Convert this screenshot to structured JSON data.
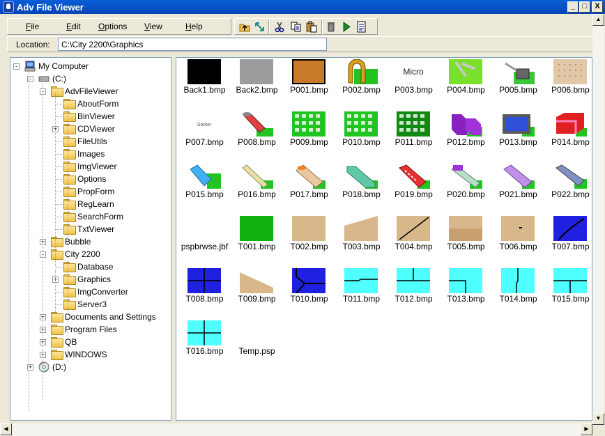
{
  "window": {
    "title": "Adv File Viewer"
  },
  "caption_buttons": {
    "minimize": "_",
    "maximize": "□",
    "close": "X"
  },
  "menu": [
    {
      "label": "File",
      "ul": "F",
      "rest": "ile"
    },
    {
      "label": "Edit",
      "ul": "E",
      "rest": "dit"
    },
    {
      "label": "Options",
      "ul": "O",
      "rest": "ptions"
    },
    {
      "label": "View",
      "ul": "V",
      "rest": "iew"
    },
    {
      "label": "Help",
      "ul": "H",
      "rest": "elp"
    }
  ],
  "toolbar": [
    {
      "icon": "folder-up-icon"
    },
    {
      "icon": "resize-icon"
    },
    {
      "icon": "cut-icon"
    },
    {
      "icon": "copy-icon"
    },
    {
      "icon": "paste-icon"
    },
    {
      "icon": "delete-icon"
    },
    {
      "icon": "run-icon"
    },
    {
      "icon": "properties-icon"
    }
  ],
  "location": {
    "label": "Location:",
    "value": "C:\\City 2200\\Graphics"
  },
  "tree": [
    {
      "label": "My Computer",
      "level": 0,
      "kind": "computer",
      "expander": "-"
    },
    {
      "label": "(C:)",
      "level": 1,
      "kind": "drive",
      "expander": "-"
    },
    {
      "label": "AdvFileViewer",
      "level": 2,
      "kind": "folder",
      "expander": "-"
    },
    {
      "label": "AboutForm",
      "level": 3,
      "kind": "folder",
      "expander": ""
    },
    {
      "label": "BinViewer",
      "level": 3,
      "kind": "folder",
      "expander": ""
    },
    {
      "label": "CDViewer",
      "level": 3,
      "kind": "folder",
      "expander": "+"
    },
    {
      "label": "FileUtils",
      "level": 3,
      "kind": "folder",
      "expander": ""
    },
    {
      "label": "Images",
      "level": 3,
      "kind": "folder",
      "expander": ""
    },
    {
      "label": "ImgViewer",
      "level": 3,
      "kind": "folder",
      "expander": ""
    },
    {
      "label": "Options",
      "level": 3,
      "kind": "folder",
      "expander": ""
    },
    {
      "label": "PropForm",
      "level": 3,
      "kind": "folder",
      "expander": ""
    },
    {
      "label": "RegLearn",
      "level": 3,
      "kind": "folder",
      "expander": ""
    },
    {
      "label": "SearchForm",
      "level": 3,
      "kind": "folder",
      "expander": ""
    },
    {
      "label": "TxtViewer",
      "level": 3,
      "kind": "folder",
      "expander": ""
    },
    {
      "label": "Bubble",
      "level": 2,
      "kind": "folder",
      "expander": "+"
    },
    {
      "label": "City 2200",
      "level": 2,
      "kind": "folder",
      "expander": "-"
    },
    {
      "label": "Database",
      "level": 3,
      "kind": "folder",
      "expander": ""
    },
    {
      "label": "Graphics",
      "level": 3,
      "kind": "folder",
      "expander": "+"
    },
    {
      "label": "ImgConverter",
      "level": 3,
      "kind": "folder",
      "expander": ""
    },
    {
      "label": "Server3",
      "level": 3,
      "kind": "folder",
      "expander": ""
    },
    {
      "label": "Documents and Settings",
      "level": 2,
      "kind": "folder",
      "expander": "+"
    },
    {
      "label": "Program Files",
      "level": 2,
      "kind": "folder",
      "expander": "+"
    },
    {
      "label": "QB",
      "level": 2,
      "kind": "folder",
      "expander": "+"
    },
    {
      "label": "WINDOWS",
      "level": 2,
      "kind": "folder",
      "expander": "+"
    },
    {
      "label": "(D:)",
      "level": 1,
      "kind": "cdrom",
      "expander": "+"
    }
  ],
  "files": [
    {
      "name": "Back1.bmp",
      "thumb": "black"
    },
    {
      "name": "Back2.bmp",
      "thumb": "gray"
    },
    {
      "name": "P001.bmp",
      "thumb": "brown"
    },
    {
      "name": "P002.bmp",
      "thumb": "arch"
    },
    {
      "name": "P003.bmp",
      "thumb": "micro",
      "text": "Micro"
    },
    {
      "name": "P004.bmp",
      "thumb": "greenpick"
    },
    {
      "name": "P005.bmp",
      "thumb": "machine"
    },
    {
      "name": "P006.bmp",
      "thumb": "dotted"
    },
    {
      "name": "P007.bmp",
      "thumb": "small",
      "text": "Sooter"
    },
    {
      "name": "P008.bmp",
      "thumb": "roll"
    },
    {
      "name": "P009.bmp",
      "thumb": "grid"
    },
    {
      "name": "P010.bmp",
      "thumb": "grid"
    },
    {
      "name": "P011.bmp",
      "thumb": "griddark"
    },
    {
      "name": "P012.bmp",
      "thumb": "purple"
    },
    {
      "name": "P013.bmp",
      "thumb": "bluebox"
    },
    {
      "name": "P014.bmp",
      "thumb": "redbox"
    },
    {
      "name": "P015.bmp",
      "thumb": "bluediag"
    },
    {
      "name": "P016.bmp",
      "thumb": "creamdiag"
    },
    {
      "name": "P017.bmp",
      "thumb": "orangediag"
    },
    {
      "name": "P018.bmp",
      "thumb": "tealdiag"
    },
    {
      "name": "P019.bmp",
      "thumb": "reddiag"
    },
    {
      "name": "P020.bmp",
      "thumb": "purplediag"
    },
    {
      "name": "P021.bmp",
      "thumb": "violetdiag"
    },
    {
      "name": "P022.bmp",
      "thumb": "graydiag"
    },
    {
      "name": "pspbrwse.jbf",
      "thumb": "none"
    },
    {
      "name": "T001.bmp",
      "thumb": "green"
    },
    {
      "name": "T002.bmp",
      "thumb": "tan"
    },
    {
      "name": "T003.bmp",
      "thumb": "tanslope"
    },
    {
      "name": "T004.bmp",
      "thumb": "tanline"
    },
    {
      "name": "T005.bmp",
      "thumb": "tanstep"
    },
    {
      "name": "T006.bmp",
      "thumb": "tandot"
    },
    {
      "name": "T007.bmp",
      "thumb": "bluecurve"
    },
    {
      "name": "T008.bmp",
      "thumb": "bluecross"
    },
    {
      "name": "T009.bmp",
      "thumb": "tanslope2"
    },
    {
      "name": "T010.bmp",
      "thumb": "bluecorner"
    },
    {
      "name": "T011.bmp",
      "thumb": "cyanh"
    },
    {
      "name": "T012.bmp",
      "thumb": "cyant"
    },
    {
      "name": "T013.bmp",
      "thumb": "cyancorner"
    },
    {
      "name": "T014.bmp",
      "thumb": "cyanv"
    },
    {
      "name": "T015.bmp",
      "thumb": "cyant2"
    },
    {
      "name": "T016.bmp",
      "thumb": "cyancross"
    },
    {
      "name": "Temp.psp",
      "thumb": "none"
    }
  ]
}
